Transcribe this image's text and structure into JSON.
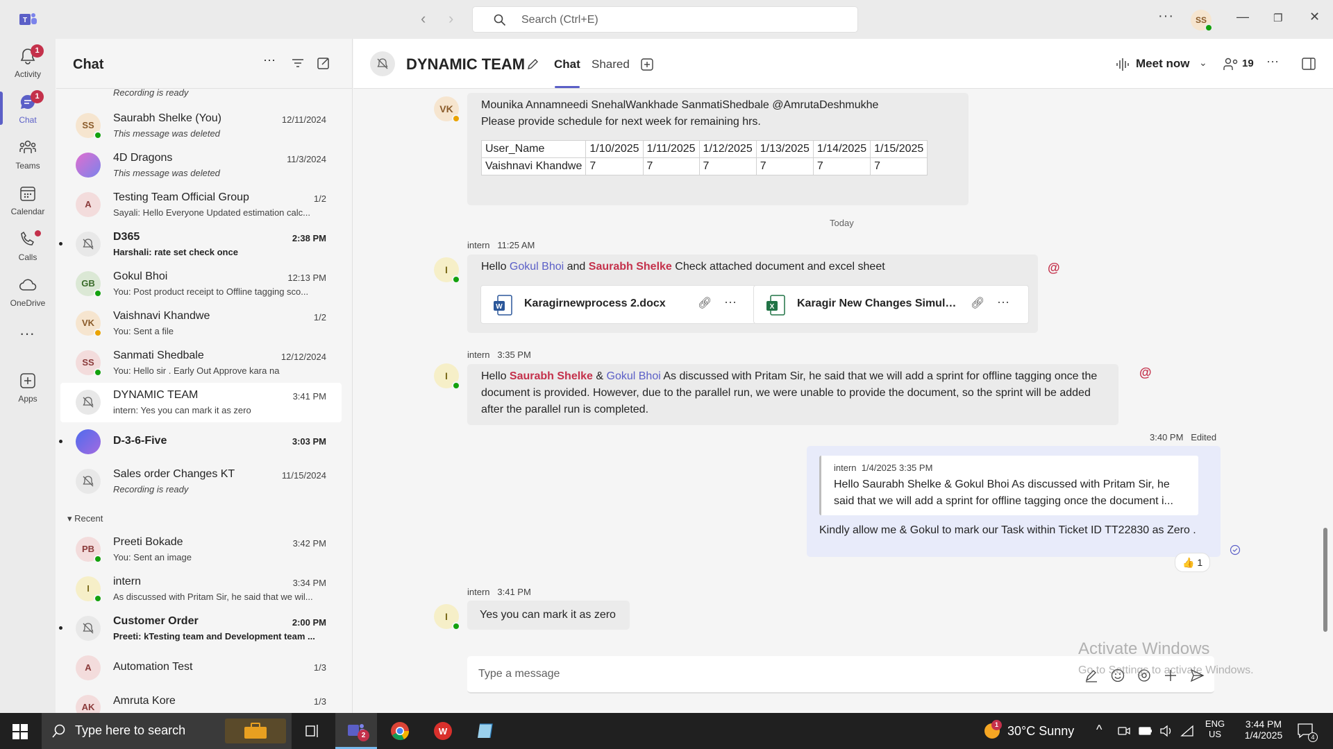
{
  "titlebar": {
    "search_placeholder": "Search (Ctrl+E)",
    "more": "···",
    "user_initials": "SS"
  },
  "rail": {
    "items": [
      {
        "label": "Activity",
        "badge": "1"
      },
      {
        "label": "Chat",
        "badge": "1"
      },
      {
        "label": "Teams"
      },
      {
        "label": "Calendar"
      },
      {
        "label": "Calls"
      },
      {
        "label": "OneDrive"
      },
      {
        "label": "Apps"
      }
    ],
    "more": "···"
  },
  "chatlist": {
    "title": "Chat",
    "items": [
      {
        "name": "",
        "preview": "Recording is ready",
        "time": ""
      },
      {
        "initials": "SS",
        "name": "Saurabh Shelke (You)",
        "preview": "This message was deleted",
        "time": "12/11/2024"
      },
      {
        "initials": "",
        "name": "4D Dragons",
        "preview": "This message was deleted",
        "time": "11/3/2024"
      },
      {
        "initials": "A",
        "name": "Testing Team Official Group",
        "preview": "Sayali: Hello Everyone Updated estimation calc...",
        "time": "1/2"
      },
      {
        "initials": "",
        "name": "D365",
        "preview": "Harshali: rate set check once",
        "time": "2:38 PM"
      },
      {
        "initials": "GB",
        "name": "Gokul Bhoi",
        "preview": "You: Post product receipt to Offline tagging sco...",
        "time": "12:13 PM"
      },
      {
        "initials": "VK",
        "name": "Vaishnavi Khandwe",
        "preview": "You: Sent a file",
        "time": "1/2"
      },
      {
        "initials": "SS",
        "name": "Sanmati Shedbale",
        "preview": "You: Hello sir . Early Out Approve kara na",
        "time": "12/12/2024"
      },
      {
        "initials": "",
        "name": "DYNAMIC TEAM",
        "preview": "intern: Yes you can mark it as zero",
        "time": "3:41 PM"
      },
      {
        "initials": "",
        "name": "D-3-6-Five",
        "preview": "",
        "time": "3:03 PM"
      },
      {
        "initials": "",
        "name": "Sales order Changes KT",
        "preview": "Recording is ready",
        "time": "11/15/2024"
      }
    ],
    "recent_label": "Recent",
    "recent_items": [
      {
        "initials": "PB",
        "name": "Preeti Bokade",
        "preview": "You: Sent an image",
        "time": "3:42 PM"
      },
      {
        "initials": "I",
        "name": "intern",
        "preview": "As discussed with Pritam Sir, he said that we wil...",
        "time": "3:34 PM"
      },
      {
        "initials": "",
        "name": "Customer Order",
        "preview": "Preeti: kTesting team and Development team ...",
        "time": "2:00 PM"
      },
      {
        "initials": "A",
        "name": "Automation Test",
        "preview": "",
        "time": "1/3"
      },
      {
        "initials": "AK",
        "name": "Amruta Kore",
        "preview": "",
        "time": "1/3"
      }
    ]
  },
  "main": {
    "group_name": "DYNAMIC TEAM",
    "tabs": [
      "Chat",
      "Shared"
    ],
    "meet_now": "Meet now",
    "participants": "19",
    "msg1": {
      "avatar": "VK",
      "line1": "Mounika Annamneedi SnehalWankhade SanmatiShedbale @AmrutaDeshmukhe",
      "line2": "Please provide schedule for next week for remaining hrs.",
      "table": {
        "header": [
          "User_Name",
          "1/10/2025",
          "1/11/2025",
          "1/12/2025",
          "1/13/2025",
          "1/14/2025",
          "1/15/2025"
        ],
        "rows": [
          [
            "Vaishnavi Khandwe",
            "7",
            "7",
            "7",
            "7",
            "7",
            "7"
          ]
        ]
      }
    },
    "day_separator": "Today",
    "msg2": {
      "author": "intern",
      "time": "11:25 AM",
      "avatar": "I",
      "p1": "Hello ",
      "m1": "Gokul Bhoi",
      "p2": " and ",
      "m2": "Saurabh Shelke",
      "p3": " Check attached document and excel sheet",
      "file1": "Karagirnewprocess 2.docx",
      "file2": "Karagir New Changes Simulat..."
    },
    "msg3": {
      "author": "intern",
      "time": "3:35 PM",
      "avatar": "I",
      "p1": "Hello ",
      "m1": "Saurabh Shelke",
      "p2": " & ",
      "m2": "Gokul Bhoi",
      "p3": " As discussed with Pritam Sir, he said that we will add a sprint for offline tagging once the document is provided. However, due to the parallel run, we were unable to provide the document, so the sprint will be added after the parallel run is completed."
    },
    "msg4": {
      "time": "3:40 PM",
      "edited": "Edited",
      "quote_author": "intern",
      "quote_time": "1/4/2025 3:35 PM",
      "quote_text": "Hello Saurabh Shelke & Gokul Bhoi As discussed with Pritam Sir, he said that we will add a sprint for offline tagging once the document i...",
      "text": "Kindly allow me & Gokul to mark our Task within Ticket ID TT22830 as Zero .",
      "reaction_count": "1"
    },
    "msg5": {
      "author": "intern",
      "time": "3:41 PM",
      "avatar": "I",
      "text": "Yes you can mark it as zero"
    },
    "compose_placeholder": "Type a message",
    "watermark_title": "Activate Windows",
    "watermark_sub": "Go to Settings to activate Windows."
  },
  "taskbar": {
    "search_placeholder": "Type here to search",
    "teams_badge": "2",
    "weather": "30°C  Sunny",
    "lang1": "ENG",
    "lang2": "US",
    "time": "3:44 PM",
    "date": "1/4/2025",
    "notif_count": "4"
  }
}
